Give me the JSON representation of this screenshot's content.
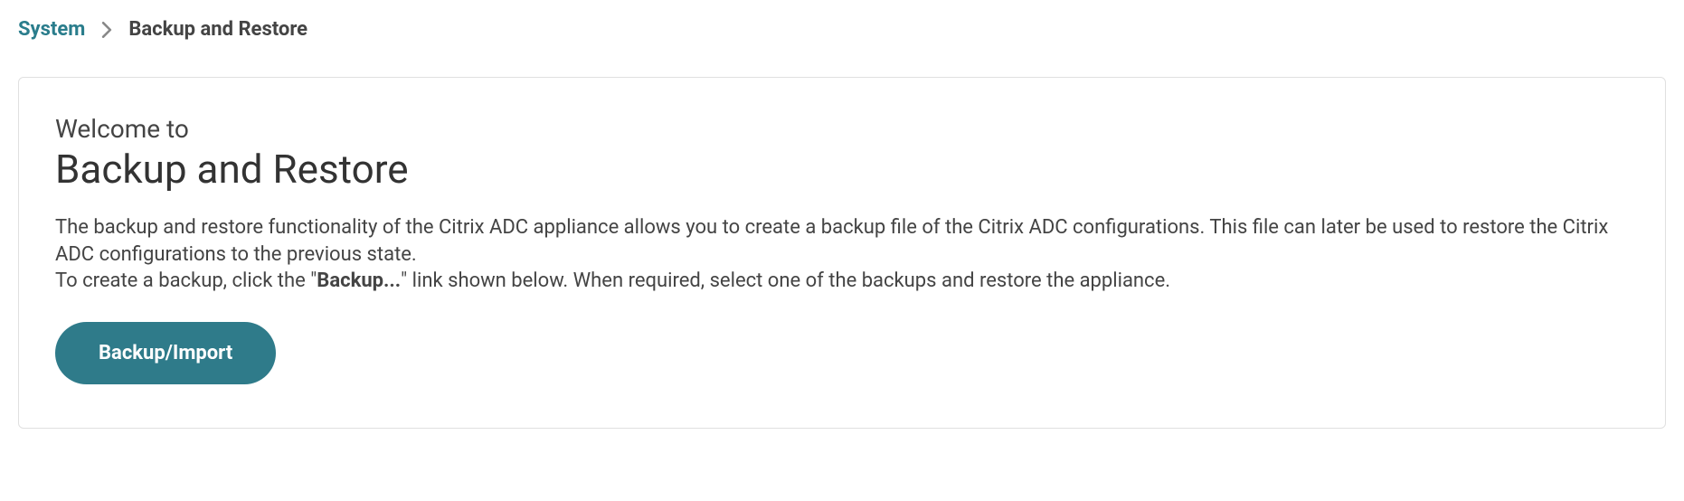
{
  "breadcrumb": {
    "root": "System",
    "current": "Backup and Restore"
  },
  "panel": {
    "welcome": "Welcome to",
    "title": "Backup and Restore",
    "desc_part1": "The backup and restore functionality of the Citrix ADC appliance allows you to create a backup file of the Citrix ADC configurations. This file can later be used to restore the Citrix ADC configurations to the previous state.",
    "desc_part2_pre": "To create a backup, click the \"",
    "desc_part2_bold": "Backup...",
    "desc_part2_post": "\" link shown below. When required, select one of the backups and restore the appliance.",
    "button_label": "Backup/Import"
  }
}
